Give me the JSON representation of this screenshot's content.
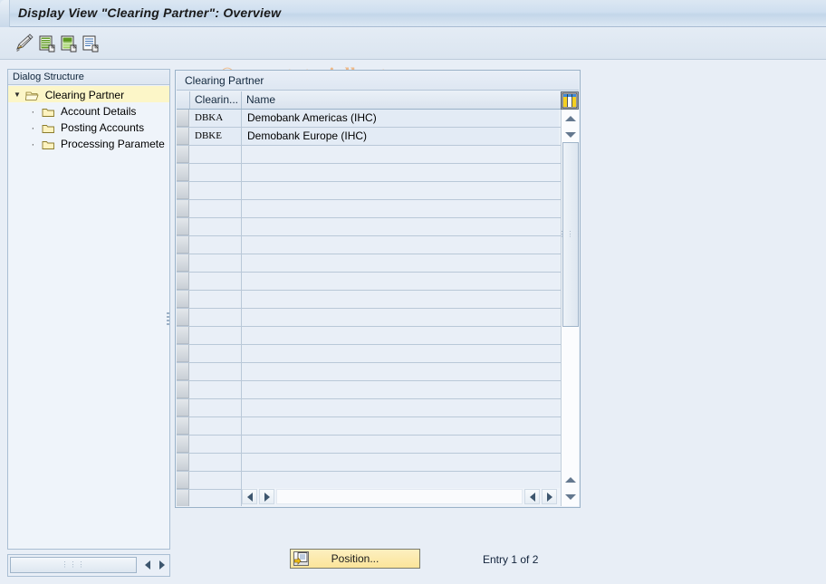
{
  "window": {
    "title": "Display View \"Clearing Partner\": Overview"
  },
  "watermark": {
    "text": "© www.tutorialkart.com",
    "color": "#efb988"
  },
  "toolbar": {
    "buttons": [
      {
        "name": "display-change-icon",
        "tooltip": "Display -> Change"
      },
      {
        "name": "new-entries-icon",
        "tooltip": "New Entries"
      },
      {
        "name": "copy-as-icon",
        "tooltip": "Copy As..."
      },
      {
        "name": "details-icon",
        "tooltip": "Details"
      }
    ]
  },
  "sidebar": {
    "header": "Dialog Structure",
    "items": [
      {
        "label": "Clearing Partner",
        "level": 0,
        "selected": true,
        "icon": "folder-open-icon",
        "expanded": true
      },
      {
        "label": "Account Details",
        "level": 1,
        "selected": false,
        "icon": "folder-icon"
      },
      {
        "label": "Posting Accounts",
        "level": 1,
        "selected": false,
        "icon": "folder-icon"
      },
      {
        "label": "Processing Paramete",
        "level": 1,
        "selected": false,
        "icon": "folder-icon"
      }
    ]
  },
  "table": {
    "title": "Clearing Partner",
    "columns": [
      {
        "key": "id",
        "label": "Clearin..."
      },
      {
        "key": "name",
        "label": "Name"
      }
    ],
    "rows": [
      {
        "id": "DBKA",
        "name": "Demobank Americas (IHC)"
      },
      {
        "id": "DBKE",
        "name": "Demobank Europe (IHC)"
      }
    ],
    "empty_row_count": 20,
    "config_icon": "column-config-icon"
  },
  "footer": {
    "position_button": "Position...",
    "entry_status": "Entry 1 of 2"
  },
  "colors": {
    "background": "#e8eef6",
    "title_bar": "#cfdff0",
    "selected_tree_row": "#fcf6c8",
    "button_accent": "#fbe49a",
    "row_background": "#e9eff7"
  }
}
